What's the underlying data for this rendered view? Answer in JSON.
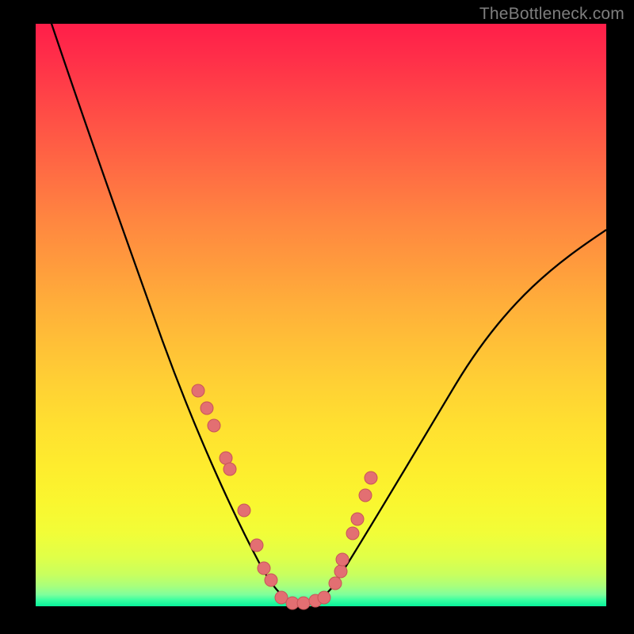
{
  "watermark": "TheBottleneck.com",
  "colors": {
    "background": "#000000",
    "curve": "#000000",
    "dot_fill": "#e36f72",
    "dot_stroke": "#c85558",
    "watermark": "#7e7e7e"
  },
  "chart_data": {
    "type": "line",
    "title": "",
    "xlabel": "",
    "ylabel": "",
    "xlim": [
      0,
      100
    ],
    "ylim": [
      0,
      100
    ],
    "grid": false,
    "legend": false,
    "series": [
      {
        "name": "bottleneck-curve",
        "x": [
          0,
          5,
          10,
          15,
          20,
          25,
          30,
          35,
          37,
          39,
          41,
          43,
          45,
          47,
          50,
          55,
          60,
          65,
          70,
          75,
          80,
          85,
          90,
          95,
          100
        ],
        "y": [
          104,
          92,
          80.5,
          69,
          57.5,
          46,
          34,
          22,
          16,
          10,
          5.5,
          2.5,
          1,
          1,
          1,
          5,
          12,
          20,
          27.5,
          34.5,
          41,
          47,
          53,
          58.5,
          64
        ]
      }
    ],
    "highlight_points": {
      "name": "scatter-dots",
      "x": [
        28.5,
        30,
        31.3,
        33.3,
        34,
        36.5,
        38.8,
        40,
        41.2,
        43,
        45,
        47,
        49,
        50.5,
        52.5,
        53.5,
        53.7,
        55.5,
        56.3,
        57.7,
        58.7
      ],
      "y": [
        37,
        34,
        31,
        25.5,
        23.5,
        16.5,
        10.5,
        6.5,
        4.5,
        1.5,
        0.5,
        0.5,
        1,
        1.5,
        4,
        6,
        8,
        12.5,
        15,
        19,
        22
      ]
    }
  }
}
